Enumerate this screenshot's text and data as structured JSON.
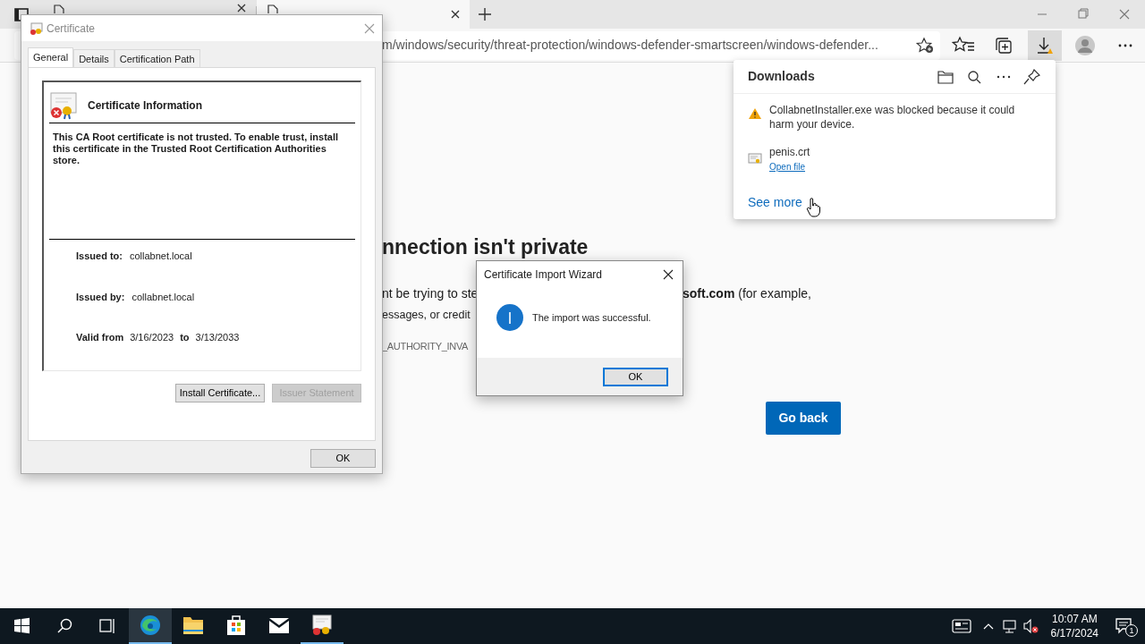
{
  "browser": {
    "tabs": [
      {
        "selected": false
      },
      {
        "selected": true
      }
    ],
    "address": "m/windows/security/threat-protection/windows-defender-smartscreen/windows-defender...",
    "downloads_active": true
  },
  "downloads": {
    "title": "Downloads",
    "items": [
      {
        "kind": "warning",
        "text": "CollabnetInstaller.exe was blocked because it could harm your device."
      },
      {
        "kind": "file",
        "name": "penis.crt",
        "action": "Open file"
      }
    ],
    "see_more": "See more"
  },
  "page": {
    "heading": "nnection isn't private",
    "line_1_start": "nt be trying to ste",
    "line_1_end": "**soft.com** (for example,",
    "line_2": "essages, or credit",
    "error_code": "_AUTHORITY_INVA",
    "button": "Go back"
  },
  "certificate_dialog": {
    "title": "Certificate",
    "tabs": [
      {
        "label": "General",
        "selected": true
      },
      {
        "label": "Details",
        "selected": false
      },
      {
        "label": "Certification Path",
        "selected": false
      }
    ],
    "heading": "Certificate Information",
    "message": "This CA Root certificate is not trusted. To enable trust, install this certificate in the Trusted Root Certification Authorities store.",
    "fields": [
      {
        "label": "Issued to:",
        "value": "collabnet.local"
      },
      {
        "label": "Issued by:",
        "value": "collabnet.local"
      }
    ],
    "valid_from_label": "Valid from",
    "valid_from": "3/16/2023",
    "to_label": "to",
    "valid_to": "3/13/2033",
    "buttons": [
      {
        "label": "Install Certificate...",
        "disabled": false
      },
      {
        "label": "Issuer Statement",
        "disabled": true
      }
    ],
    "ok": "OK"
  },
  "wizard": {
    "title": "Certificate Import Wizard",
    "message": "The import was successful.",
    "ok": "OK"
  },
  "taskbar": {
    "apps": [
      {
        "kind": "edge",
        "selected": true,
        "running": true
      },
      {
        "kind": "explorer",
        "selected": false,
        "running": false
      },
      {
        "kind": "store",
        "selected": false,
        "running": false
      },
      {
        "kind": "mail",
        "selected": false,
        "running": false
      },
      {
        "kind": "certificate",
        "selected": false,
        "running": true
      }
    ],
    "time": "10:07 AM",
    "date": "6/17/2024",
    "notifications": "1"
  }
}
